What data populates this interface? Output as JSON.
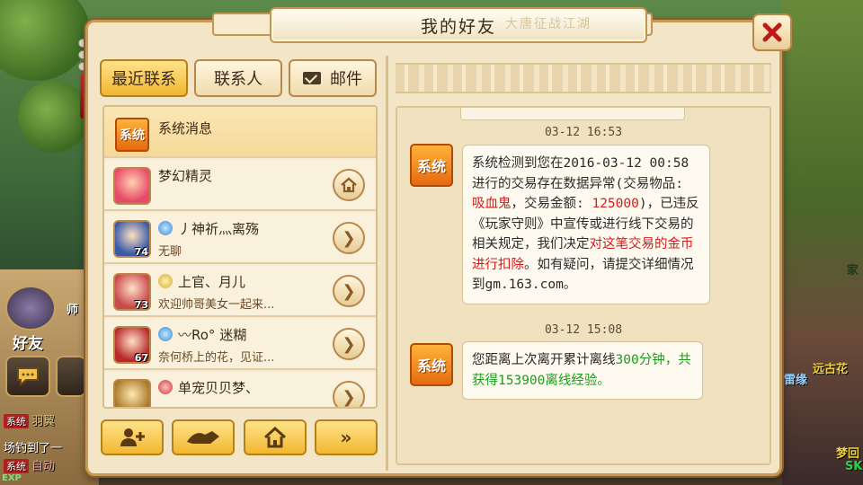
{
  "window": {
    "title": "我的好友",
    "title_deco": "大唐征战江湖"
  },
  "tabs": [
    {
      "label": "最近联系",
      "active": true
    },
    {
      "label": "联系人",
      "active": false
    },
    {
      "label": "邮件",
      "active": false,
      "icon": "mail-icon"
    }
  ],
  "contacts": [
    {
      "name": "系统消息",
      "note": "",
      "badge": "系统",
      "level": "",
      "action": ""
    },
    {
      "name": "梦幻精灵",
      "note": "",
      "badge": "",
      "level": "",
      "action": "home-icon"
    },
    {
      "name": "丿神祈灬离殇",
      "note": "无聊",
      "level": "74",
      "action": "chevron-right-icon"
    },
    {
      "name": "上官、月儿",
      "note": "欢迎帅哥美女一起来...",
      "level": "73",
      "action": "chevron-right-icon"
    },
    {
      "name": "〰Ro° 迷糊",
      "note": "奈何桥上的花，见证...",
      "level": "67",
      "action": "chevron-right-icon"
    },
    {
      "name": "单宠贝贝梦、",
      "note": "",
      "level": "",
      "action": "chevron-right-icon"
    }
  ],
  "bottom_buttons": [
    {
      "icon": "add-friend-icon"
    },
    {
      "icon": "handshake-icon"
    },
    {
      "icon": "home-icon"
    },
    {
      "icon": "double-chevron-right-icon"
    }
  ],
  "messages": [
    {
      "time": "03-12 16:53",
      "sender_badge": "系统",
      "parts": [
        {
          "t": "系统检测到您在2016-03-12 00:58进行的交易存在数据异常(交易物品: ",
          "c": "normal"
        },
        {
          "t": "吸血鬼",
          "c": "red"
        },
        {
          "t": "，交易金额: ",
          "c": "normal"
        },
        {
          "t": "125000",
          "c": "red"
        },
        {
          "t": ")，已违反《玩家守则》中宣传或进行线下交易的相关规定，我们决定",
          "c": "normal"
        },
        {
          "t": "对这笔交易的金币进行扣除",
          "c": "red"
        },
        {
          "t": "。如有疑问，请提交详细情况到gm.163.com。",
          "c": "normal"
        }
      ]
    },
    {
      "time": "03-12 15:08",
      "sender_badge": "系统",
      "parts": [
        {
          "t": "您距离上次离开累计离线",
          "c": "normal"
        },
        {
          "t": "300分钟，共获得153900离线经验。",
          "c": "green"
        }
      ]
    }
  ],
  "background": {
    "hud_friend_label": "好友",
    "hud_master_label": "师",
    "chat": [
      {
        "tag": "系统",
        "text": "羽翼"
      },
      {
        "tag": "",
        "text": "场钓到了一"
      },
      {
        "tag": "系统",
        "text": "自动"
      }
    ],
    "exp_label": "EXP",
    "right_labels": [
      "家",
      "远古花",
      "雷缘",
      "梦回",
      "SK"
    ]
  },
  "colors": {
    "accent_gold": "#f2b730",
    "warning_red": "#d41b1b",
    "reward_green": "#1f9a1f"
  }
}
